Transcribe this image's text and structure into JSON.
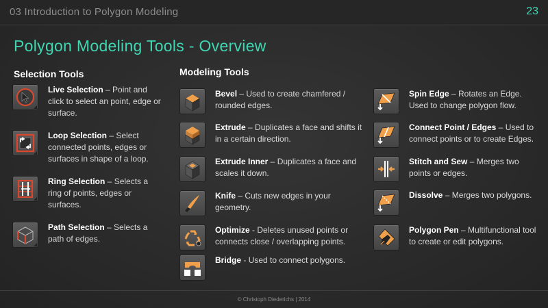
{
  "header": {
    "course_title": "03 Introduction to Polygon Modeling",
    "page_number": "23"
  },
  "slide_title": "Polygon Modeling Tools - Overview",
  "selection": {
    "heading": "Selection Tools",
    "tools": [
      {
        "name": "Live Selection",
        "sep": " – ",
        "desc": "Point and click to select an point, edge or surface.",
        "icon": "live-selection-icon"
      },
      {
        "name": "Loop Selection",
        "sep": " – ",
        "desc": "Select connected points, edges or surfaces in shape of a loop.",
        "icon": "loop-selection-icon"
      },
      {
        "name": "Ring Selection",
        "sep": " – ",
        "desc": "Selects a ring of points, edges or surfaces.",
        "icon": "ring-selection-icon"
      },
      {
        "name": "Path Selection",
        "sep": " – ",
        "desc": "Selects a path of edges.",
        "icon": "path-selection-icon"
      }
    ]
  },
  "modeling": {
    "heading": "Modeling Tools",
    "tools": [
      {
        "name": "Bevel",
        "sep": " – ",
        "desc": "Used to create chamfered / rounded edges.",
        "icon": "bevel-icon"
      },
      {
        "name": "Extrude",
        "sep": " – ",
        "desc": "Duplicates a face and shifts it in a certain direction.",
        "icon": "extrude-icon"
      },
      {
        "name": "Extrude Inner",
        "sep": " – ",
        "desc": "Duplicates a face and scales it down.",
        "icon": "extrude-inner-icon"
      },
      {
        "name": "Knife",
        "sep": " – ",
        "desc": "Cuts new edges in your geometry.",
        "icon": "knife-icon"
      },
      {
        "name": "Optimize",
        "sep": " - ",
        "desc": "Deletes unused points or connects close / overlapping points.",
        "icon": "optimize-icon"
      },
      {
        "name": "Bridge",
        "sep": " - ",
        "desc": "Used to connect polygons.",
        "icon": "bridge-icon"
      },
      {
        "name": "Spin Edge",
        "sep": " – ",
        "desc": "Rotates an Edge. Used to change polygon flow.",
        "icon": "spin-edge-icon"
      },
      {
        "name": "Connect Point / Edges",
        "sep": " – ",
        "desc": "Used to connect points or to create Edges.",
        "icon": "connect-point-edges-icon"
      },
      {
        "name": "Stitch and Sew",
        "sep": " – ",
        "desc": "Merges two points or edges.",
        "icon": "stitch-and-sew-icon"
      },
      {
        "name": "Dissolve",
        "sep": " – ",
        "desc": "Merges two polygons.",
        "icon": "dissolve-icon"
      },
      {
        "name": "Polygon Pen",
        "sep": " – ",
        "desc": "Multifunctional tool to create or edit polygons.",
        "icon": "polygon-pen-icon"
      }
    ]
  },
  "footer": {
    "copyright": "© Christoph Diederichs | 2014"
  },
  "colors": {
    "accent": "#3fd6b2",
    "icon_orange": "#f0a04b",
    "icon_red": "#d8482f"
  }
}
